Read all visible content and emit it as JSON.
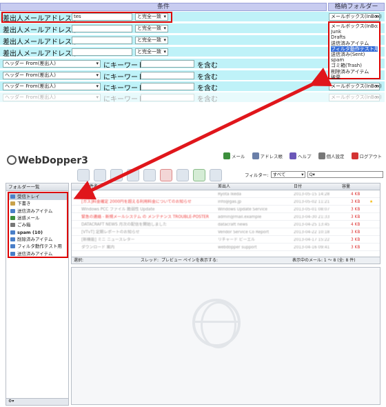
{
  "rules": {
    "header_condition": "条件",
    "header_folder": "格納フォルダー",
    "rows": [
      {
        "label": "差出人メールアドレスが",
        "value": "tes",
        "match": "と完全一致",
        "folder": "メールボックス(InBox)"
      },
      {
        "label": "差出人メールアドレスが",
        "value": "",
        "match": "と完全一致",
        "folder": "メールボックス(InBox)"
      },
      {
        "label": "差出人メールアドレスが",
        "value": "",
        "match": "と完全一致",
        "folder": "メールボックス(InBox)"
      },
      {
        "label": "差出人メールアドレスが",
        "value": "",
        "match": "と完全一致",
        "folder": "メールボックス(InBox)"
      }
    ],
    "header_rows": [
      {
        "field": "ヘッダー  From(差出人)",
        "mid": "にキーワード",
        "tail": "を含む",
        "folder": "メールボックス(InBox)"
      },
      {
        "field": "ヘッダー  From(差出人)",
        "mid": "にキーワード",
        "tail": "を含む",
        "folder": "メールボックス(InBox)"
      },
      {
        "field": "ヘッダー  From(差出人)",
        "mid": "にキーワード",
        "tail": "を含む",
        "folder": "メールボックス(InBox)"
      },
      {
        "field": "ヘッダー  From(差出人)",
        "mid": "にキーワード",
        "tail": "を含む",
        "folder": "メールボックス(InBox)"
      }
    ],
    "dropdown_options": [
      "メールボックス(InBox)",
      "Junk",
      "Drafts",
      "送信済みアイテム",
      "フィルタ動作テスト用",
      "送信済み(Sent)",
      "spam",
      "ゴミ箱(Trash)",
      "削除済みアイテム",
      "破棄"
    ],
    "dropdown_selected_index": 4
  },
  "app": {
    "logo_text": "WebDopper3",
    "nav": [
      {
        "label": "メール",
        "icon": "mail-icon",
        "color": "#3c8f3c"
      },
      {
        "label": "アドレス帳",
        "icon": "addressbook-icon",
        "color": "#6a7fa8"
      },
      {
        "label": "ヘルプ",
        "icon": "help-icon",
        "color": "#6b57b8"
      },
      {
        "label": "個人設定",
        "icon": "settings-icon",
        "color": "#777777"
      },
      {
        "label": "ログアウト",
        "icon": "logout-icon",
        "color": "#d33333"
      }
    ],
    "filter_label": "フィルター:",
    "filter_value": "すべて",
    "search_placeholder": "Q▾",
    "folder_panel_title": "フォルダー一覧",
    "folders": [
      {
        "label": "受信トレイ",
        "selected": true,
        "bold": false
      },
      {
        "label": "下書き",
        "selected": false,
        "bold": false
      },
      {
        "label": "送信済みアイテム",
        "selected": false,
        "bold": false
      },
      {
        "label": "迷惑メール",
        "selected": false,
        "bold": false
      },
      {
        "label": "ごみ箱",
        "selected": false,
        "bold": false
      },
      {
        "label": "spam (10)",
        "selected": false,
        "bold": true
      },
      {
        "label": "削除済みアイテム",
        "selected": false,
        "bold": false
      },
      {
        "label": "フィルタ動作テスト用",
        "selected": false,
        "bold": false
      },
      {
        "label": "送信済みアイテム",
        "selected": false,
        "bold": false
      }
    ],
    "list_headers": {
      "subject": "件名",
      "sender": "差出人",
      "date": "日付",
      "size": "容量"
    },
    "messages": [
      {
        "subject": "Tiltle 1",
        "sender": "Ryota Ikeda",
        "date": "2013-05-15 14:28",
        "size": "4 KB",
        "star": false,
        "red": false
      },
      {
        "subject": "[ガス]料金確定 2000円を超える利用料金についてのお知らせ",
        "sender": "info@gas.jp",
        "date": "2013-05-02 11:21",
        "size": "3 KB",
        "star": true,
        "red": true
      },
      {
        "subject": "Windows PCC ファイル 脆弱性 Update",
        "sender": "Windows Update Service",
        "date": "2013-05-01 08:07",
        "size": "3 KB",
        "star": false,
        "red": false
      },
      {
        "subject": "緊急の連絡 - 新規メールシステム の メンテナンス TROUBLE-POSTER",
        "sender": "admin@mail.example",
        "date": "2013-04-30 21:33",
        "size": "3 KB",
        "star": false,
        "red": true
      },
      {
        "subject": "DATACRAFT NEWS 月次の配信を開始しました",
        "sender": "datacraft news",
        "date": "2013-04-25 13:45",
        "size": "4 KB",
        "star": false,
        "red": false
      },
      {
        "subject": "[VTvT] 定期レポートのお知らせ",
        "sender": "Vendor Service Co Report",
        "date": "2013-04-22 10:18",
        "size": "3 KB",
        "star": false,
        "red": false
      },
      {
        "subject": "[新機能] ミニ ニュースレター",
        "sender": "リチャード ビーエル",
        "date": "2013-04-17 15:22",
        "size": "3 KB",
        "star": false,
        "red": false
      },
      {
        "subject": "ダウンロード 案内",
        "sender": "webdopper support",
        "date": "2013-04-16 09:41",
        "size": "3 KB",
        "star": false,
        "red": false
      }
    ],
    "list_footer": {
      "select_label": "選択:",
      "thread_label": "スレッド:",
      "preview_label": "プレビュー  ペインを表示する:",
      "paging": "表示中のメール: 1 ～ 8 (全: 8 件)"
    },
    "sidebar_footer": "⚙▾"
  }
}
